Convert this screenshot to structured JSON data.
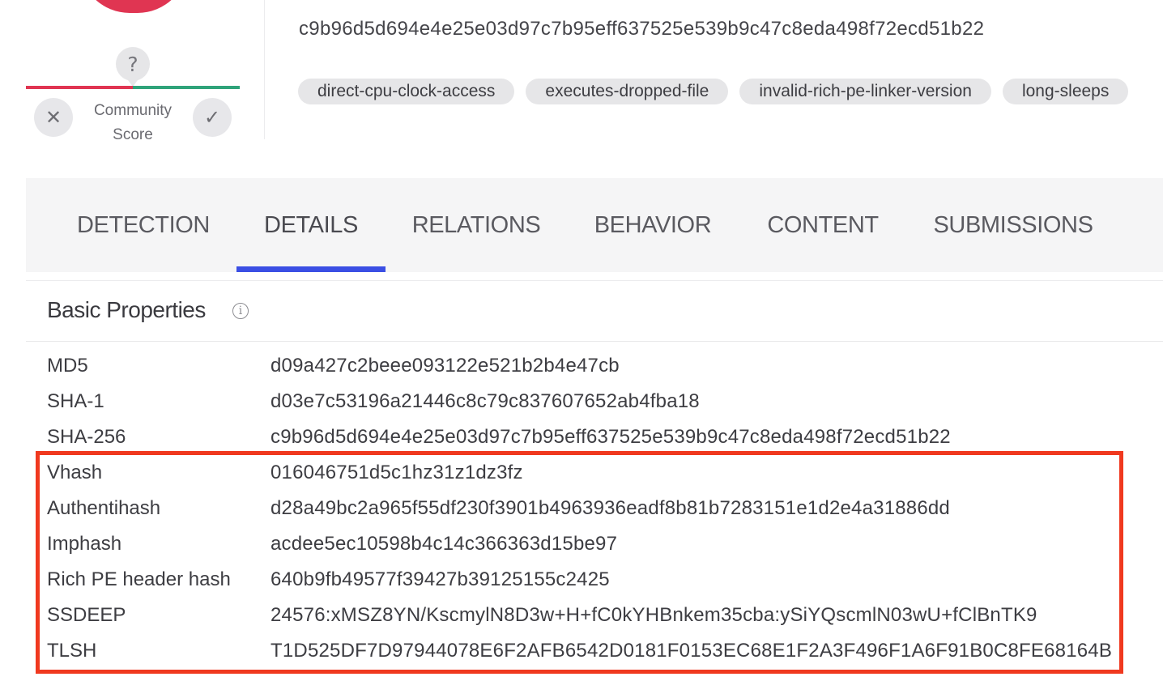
{
  "score": {
    "unknown_icon": "?",
    "label_line1": "Community",
    "label_line2": "Score",
    "downvote_icon": "✕",
    "upvote_icon": "✓",
    "colors": {
      "malicious": "#e03552",
      "harmless": "#2fa37a"
    }
  },
  "file_hash": "c9b96d5d694e4e25e03d97c7b95eff637525e539b9c47c8eda498f72ecd51b22",
  "tags": [
    "direct-cpu-clock-access",
    "executes-dropped-file",
    "invalid-rich-pe-linker-version",
    "long-sleeps"
  ],
  "tabs": [
    "DETECTION",
    "DETAILS",
    "RELATIONS",
    "BEHAVIOR",
    "CONTENT",
    "SUBMISSIONS"
  ],
  "active_tab": "DETAILS",
  "accent_color": "#3b4fe4",
  "highlight_color": "#f0391f",
  "basic_properties": {
    "title": "Basic Properties",
    "info_icon": "i",
    "rows": [
      {
        "key": "MD5",
        "value": "d09a427c2beee093122e521b2b4e47cb"
      },
      {
        "key": "SHA-1",
        "value": "d03e7c53196a21446c8c79c837607652ab4fba18"
      },
      {
        "key": "SHA-256",
        "value": "c9b96d5d694e4e25e03d97c7b95eff637525e539b9c47c8eda498f72ecd51b22"
      },
      {
        "key": "Vhash",
        "value": "016046751d5c1hz31z1dz3fz"
      },
      {
        "key": "Authentihash",
        "value": "d28a49bc2a965f55df230f3901b4963936eadf8b81b7283151e1d2e4a31886dd"
      },
      {
        "key": "Imphash",
        "value": "acdee5ec10598b4c14c366363d15be97"
      },
      {
        "key": "Rich PE header hash",
        "value": "640b9fb49577f39427b39125155c2425"
      },
      {
        "key": "SSDEEP",
        "value": "24576:xMSZ8YN/KscmylN8D3w+H+fC0kYHBnkem35cba:ySiYQscmlN03wU+fClBnTK9"
      },
      {
        "key": "TLSH",
        "value": "T1D525DF7D97944078E6F2AFB6542D0181F0153EC68E1F2A3F496F1A6F91B0C8FE68164B"
      }
    ]
  }
}
